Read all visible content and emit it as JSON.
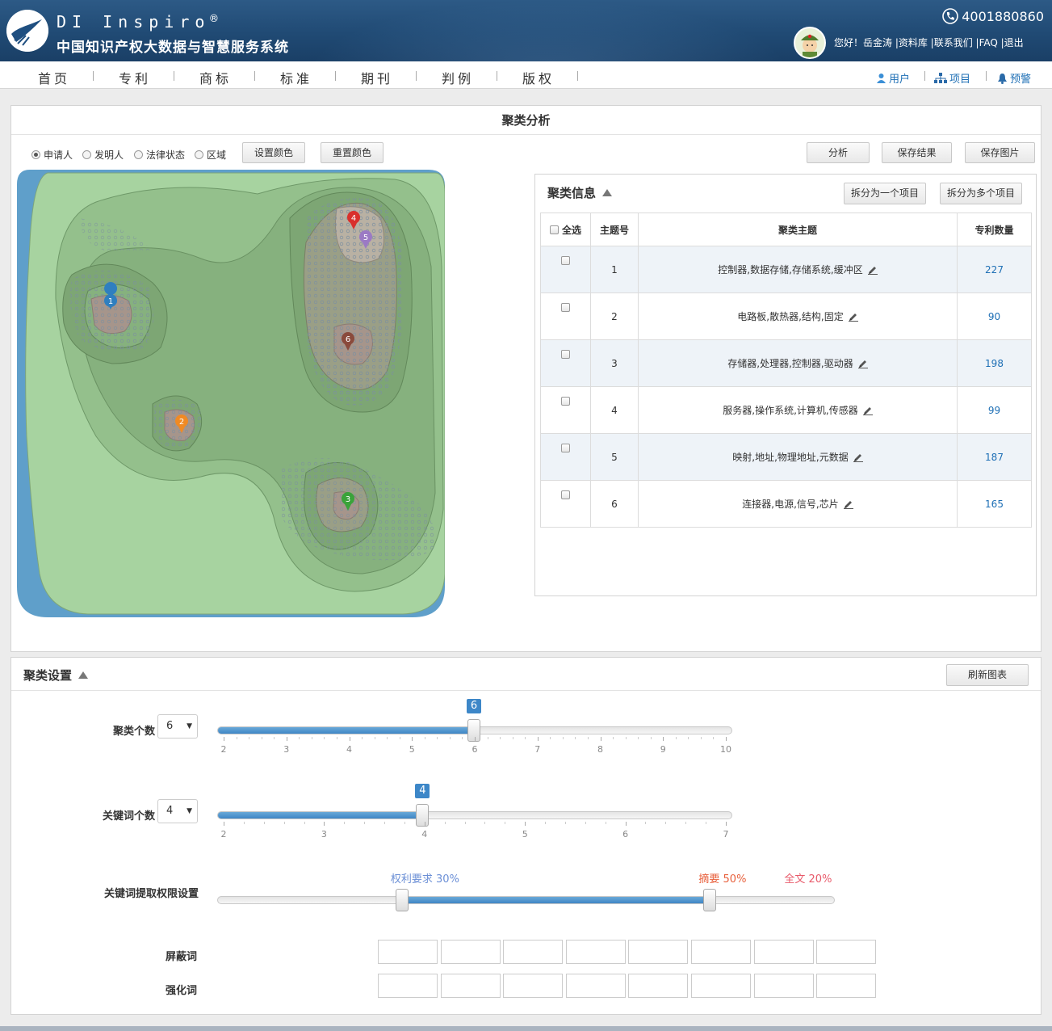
{
  "header": {
    "brand": "DI Inspiro",
    "brand_mark": "®",
    "system_title": "中国知识产权大数据与智慧服务系统",
    "phone": "4001880860",
    "user_links": "您好！岳金涛 |资料库 |联系我们 |FAQ |退出"
  },
  "nav": {
    "items": [
      "首页",
      "专利",
      "商标",
      "标准",
      "期刊",
      "判例",
      "版权"
    ],
    "right": [
      "用户",
      "项目",
      "预警"
    ]
  },
  "analysis": {
    "title": "聚类分析",
    "radios": [
      {
        "label": "申请人",
        "checked": true
      },
      {
        "label": "发明人",
        "checked": false
      },
      {
        "label": "法律状态",
        "checked": false
      },
      {
        "label": "区域",
        "checked": false
      }
    ],
    "btn_set_color": "设置颜色",
    "btn_reset_color": "重置颜色",
    "btn_analyze": "分析",
    "btn_save_result": "保存结果",
    "btn_save_image": "保存图片",
    "map_markers": [
      "1",
      "2",
      "3",
      "4",
      "5",
      "6"
    ],
    "marker_colors": [
      "#2f7fbf",
      "#f08a24",
      "#3aa33a",
      "#d9302c",
      "#9b7ac4",
      "#8a4a3c"
    ]
  },
  "cluster_info": {
    "title": "聚类信息",
    "btn_split_one": "拆分为一个项目",
    "btn_split_many": "拆分为多个项目",
    "headers": {
      "select_all": "全选",
      "topic_no": "主题号",
      "topic": "聚类主题",
      "count": "专利数量"
    },
    "rows": [
      {
        "no": "1",
        "topic": "控制器,数据存储,存储系统,缓冲区",
        "count": "227"
      },
      {
        "no": "2",
        "topic": "电路板,散热器,结构,固定",
        "count": "90"
      },
      {
        "no": "3",
        "topic": "存储器,处理器,控制器,驱动器",
        "count": "198"
      },
      {
        "no": "4",
        "topic": "服务器,操作系统,计算机,传感器",
        "count": "99"
      },
      {
        "no": "5",
        "topic": "映射,地址,物理地址,元数据",
        "count": "187"
      },
      {
        "no": "6",
        "topic": "连接器,电源,信号,芯片",
        "count": "165"
      }
    ]
  },
  "settings": {
    "title": "聚类设置",
    "btn_refresh": "刷新图表",
    "cluster_count": {
      "label": "聚类个数",
      "value": "6",
      "min": 2,
      "max": 10,
      "ticks": [
        "2",
        "3",
        "4",
        "5",
        "6",
        "7",
        "8",
        "9",
        "10"
      ]
    },
    "keyword_count": {
      "label": "关键词个数",
      "value": "4",
      "min": 2,
      "max": 7,
      "ticks": [
        "2",
        "3",
        "4",
        "5",
        "6",
        "7"
      ]
    },
    "weights": {
      "label": "关键词提取权限设置",
      "claims": "权利要求 30%",
      "abstract": "摘要 50%",
      "fulltext": "全文 20%",
      "claims_pct": 30,
      "abstract_pct": 50,
      "fulltext_pct": 20,
      "claims_color": "#6b8fd6",
      "abstract_color": "#e8603c",
      "fulltext_color": "#e85a6a"
    },
    "block_words_label": "屏蔽词",
    "boost_words_label": "强化词"
  }
}
